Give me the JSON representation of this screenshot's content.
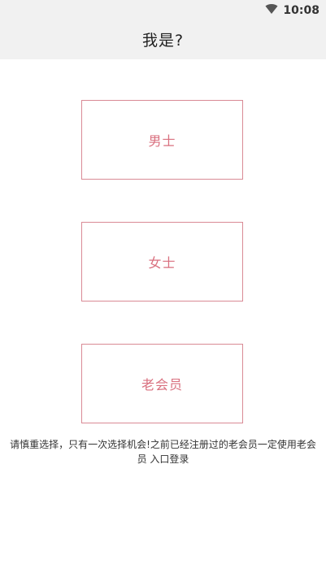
{
  "status_bar": {
    "time": "10:08",
    "icons": [
      "wifi-icon"
    ]
  },
  "header": {
    "title": "我是?"
  },
  "options": [
    {
      "label": "男士"
    },
    {
      "label": "女士"
    },
    {
      "label": "老会员"
    }
  ],
  "notice": {
    "text": "请慎重选择，只有一次选择机会!之前已经注册过的老会员一定使用老会员 入口登录"
  },
  "colors": {
    "accent": "#d9707f",
    "border": "#d98a95",
    "header_bg": "#f1f1f1"
  }
}
